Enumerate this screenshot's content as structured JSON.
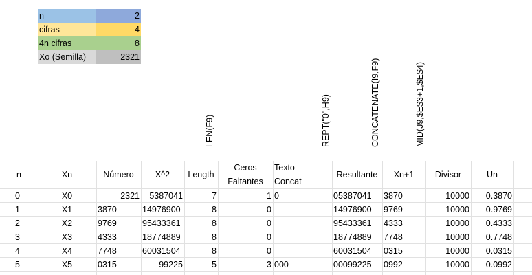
{
  "params": [
    {
      "label": "n",
      "value": "2",
      "label_bg": "#9bc2e6",
      "value_bg": "#8ea9db"
    },
    {
      "label": "cifras",
      "value": "4",
      "label_bg": "#ffe699",
      "value_bg": "#ffd966"
    },
    {
      "label": "4n cifras",
      "value": "8",
      "label_bg": "#a9d08e",
      "value_bg": "#a9d08e"
    },
    {
      "label": "Xo (Semilla)",
      "value": "2321",
      "label_bg": "#d9d9d9",
      "value_bg": "#bfbfbf"
    }
  ],
  "formulas": {
    "length": "LEN(F9)",
    "rept": "REPT(\"0\",H9)",
    "concat": "CONCATENATE(I9,F9)",
    "mid": "MID(J9,$E$3+1,$E$4)"
  },
  "headers": {
    "n": "n",
    "xn": "Xn",
    "numero": "Número",
    "x2": "X^2",
    "length": "Length",
    "ceros_1": "Ceros",
    "ceros_2": "Faltantes",
    "texto_1": "Texto",
    "texto_2": "Concat",
    "resultante": "Resultante",
    "xn1": "Xn+1",
    "divisor": "Divisor",
    "un": "Un"
  },
  "rows": [
    {
      "n": "0",
      "xn": "X0",
      "numero": "2321",
      "x2": "5387041",
      "length": "7",
      "ceros": "1",
      "texto": "0",
      "resultante": "05387041",
      "xn1": "3870",
      "divisor": "10000",
      "un": "0.3870"
    },
    {
      "n": "1",
      "xn": "X1",
      "numero": "3870",
      "x2": "14976900",
      "length": "8",
      "ceros": "0",
      "texto": "",
      "resultante": "14976900",
      "xn1": "9769",
      "divisor": "10000",
      "un": "0.9769"
    },
    {
      "n": "2",
      "xn": "X2",
      "numero": "9769",
      "x2": "95433361",
      "length": "8",
      "ceros": "0",
      "texto": "",
      "resultante": "95433361",
      "xn1": "4333",
      "divisor": "10000",
      "un": "0.4333"
    },
    {
      "n": "3",
      "xn": "X3",
      "numero": "4333",
      "x2": "18774889",
      "length": "8",
      "ceros": "0",
      "texto": "",
      "resultante": "18774889",
      "xn1": "7748",
      "divisor": "10000",
      "un": "0.7748"
    },
    {
      "n": "4",
      "xn": "X4",
      "numero": "7748",
      "x2": "60031504",
      "length": "8",
      "ceros": "0",
      "texto": "",
      "resultante": "60031504",
      "xn1": "0315",
      "divisor": "10000",
      "un": "0.0315"
    },
    {
      "n": "5",
      "xn": "X5",
      "numero": "0315",
      "x2": "99225",
      "length": "5",
      "ceros": "3",
      "texto": "000",
      "resultante": "00099225",
      "xn1": "0992",
      "divisor": "10000",
      "un": "0.0992"
    }
  ]
}
